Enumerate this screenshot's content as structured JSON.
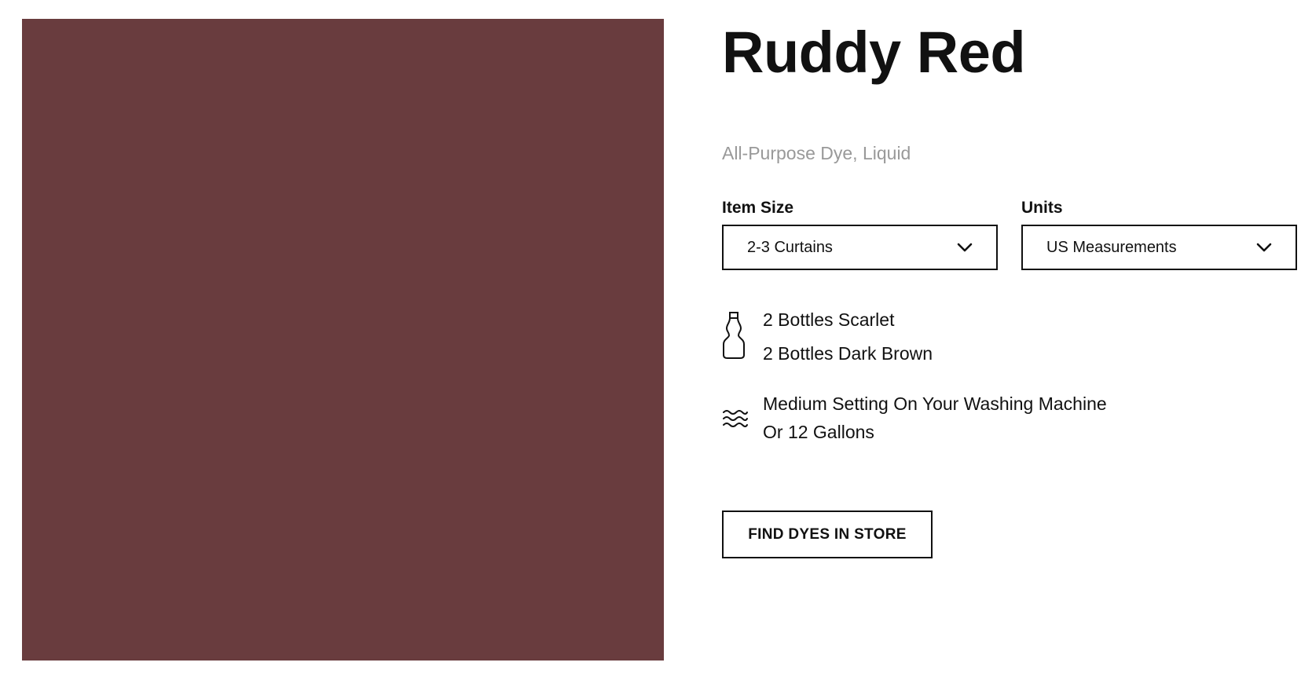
{
  "product": {
    "name": "Ruddy Red",
    "subtitle": "All-Purpose Dye, Liquid",
    "swatch_color": "#693C3E"
  },
  "item_size": {
    "label": "Item Size",
    "selected": "2-3 Curtains",
    "icon": "chevron-down-icon"
  },
  "units": {
    "label": "Units",
    "selected": "US Measurements",
    "icon": "chevron-down-icon"
  },
  "recipe": {
    "icon": "bottle-icon",
    "items": [
      "2 Bottles Scarlet",
      "2 Bottles Dark Brown"
    ]
  },
  "water": {
    "icon": "water-waves-icon",
    "lines": [
      "Medium Setting On Your Washing Machine",
      "Or 12 Gallons"
    ]
  },
  "cta": {
    "label": "FIND DYES IN STORE"
  }
}
